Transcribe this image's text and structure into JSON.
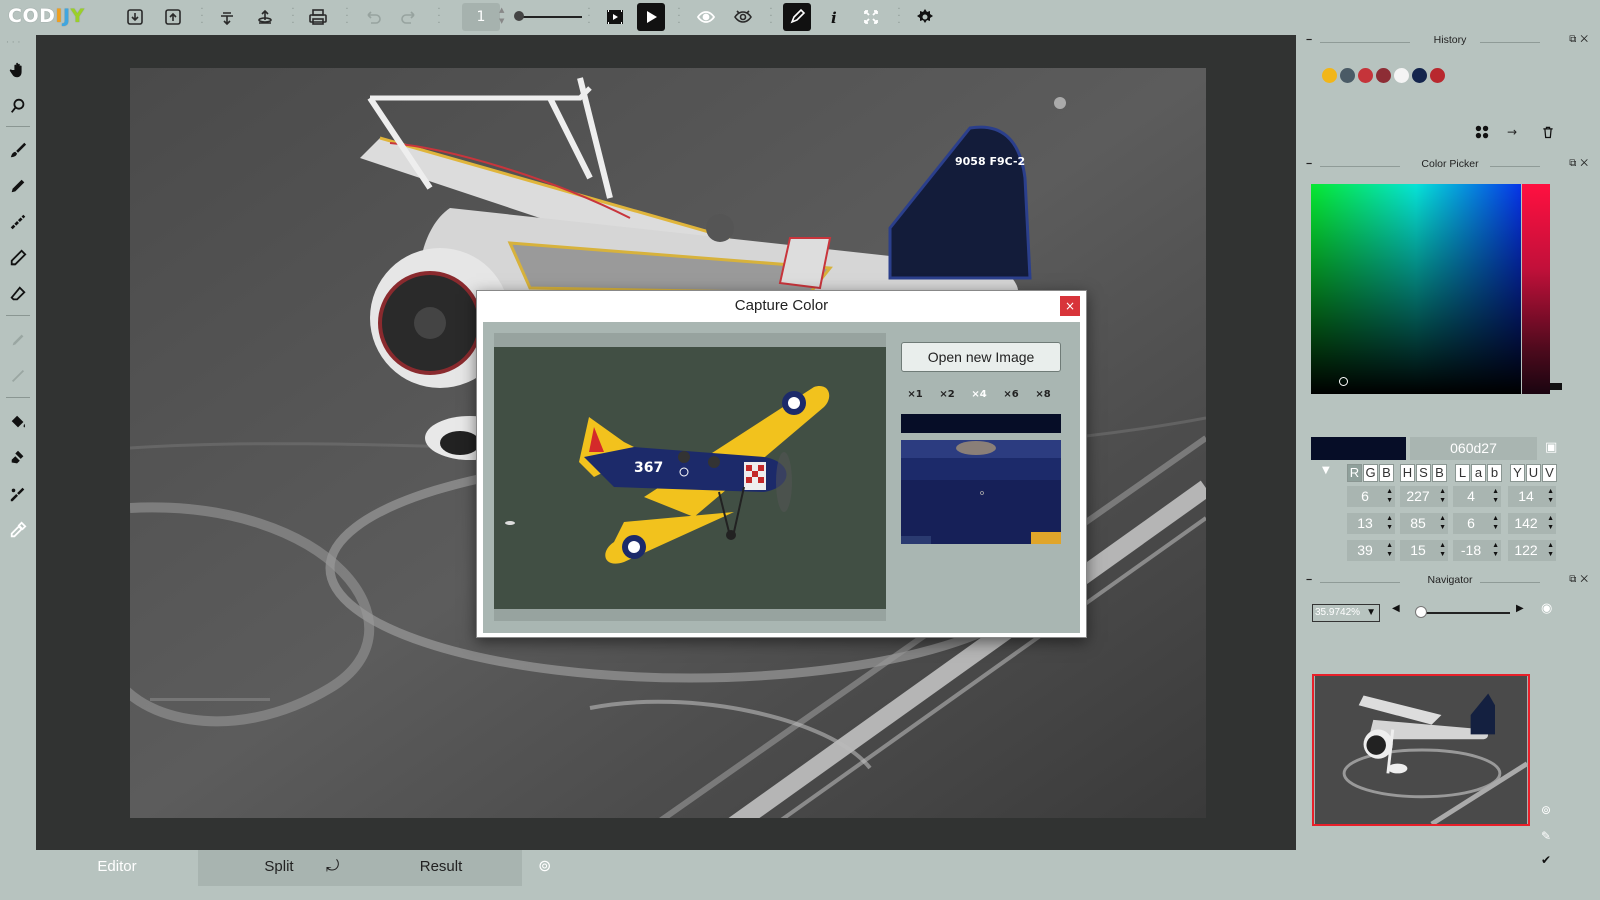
{
  "app": {
    "logo_text": "CODIJY",
    "logo_colors": [
      "#ffffff",
      "#ffffff",
      "#ffffff",
      "#f0a020",
      "#3fa6e0",
      "#9bd028"
    ]
  },
  "toolbar": {
    "page_number": "1",
    "icons": [
      "import-icon",
      "export-icon",
      "cloud-download-icon",
      "cloud-upload-icon",
      "print-icon",
      "undo-icon",
      "redo-icon",
      "page-slider",
      "film-icon",
      "play-icon",
      "eye-icon",
      "eye-outline-icon",
      "pen-icon",
      "info-icon",
      "fullscreen-icon",
      "settings-icon"
    ]
  },
  "left_tools": [
    "hand-icon",
    "zoom-icon",
    "brush-icon",
    "pencil-icon",
    "dotted-brush-icon",
    "marker-icon",
    "eraser-icon",
    "disabled-tool-icon",
    "disabled-line-icon",
    "fill-bucket-icon",
    "stamp-icon",
    "color-sampler-icon",
    "eyedropper-icon"
  ],
  "tabs": {
    "editor": "Editor",
    "split": "Split",
    "result": "Result"
  },
  "history": {
    "title": "History",
    "colors": [
      "#f2b619",
      "#4a5b66",
      "#c5343a",
      "#8d2d35",
      "#f4f4f4",
      "#14254d",
      "#b8282e"
    ]
  },
  "color_picker": {
    "title": "Color Picker",
    "hex": "060d27",
    "current_color": "#060d27",
    "modes_row1": [
      "R",
      "G",
      "B"
    ],
    "modes_row2": [
      "H",
      "S",
      "B"
    ],
    "modes_row3": [
      "L",
      "a",
      "b"
    ],
    "modes_row4": [
      "Y",
      "U",
      "V"
    ],
    "values": [
      [
        "6",
        "227",
        "4",
        "14"
      ],
      [
        "13",
        "85",
        "6",
        "142"
      ],
      [
        "39",
        "15",
        "-18",
        "122"
      ]
    ]
  },
  "navigator": {
    "title": "Navigator",
    "zoom": "35.9742%"
  },
  "dialog": {
    "title": "Capture Color",
    "close_label": "×",
    "open_button": "Open new Image",
    "zoom_options": [
      "×1",
      "×2",
      "×4",
      "×6",
      "×8"
    ],
    "selected_zoom": "×4",
    "captured_color": "#060d27"
  },
  "canvas_labels": {
    "tail_code": "9058 F9C-2"
  },
  "preview_labels": {
    "plane_number": "367"
  }
}
